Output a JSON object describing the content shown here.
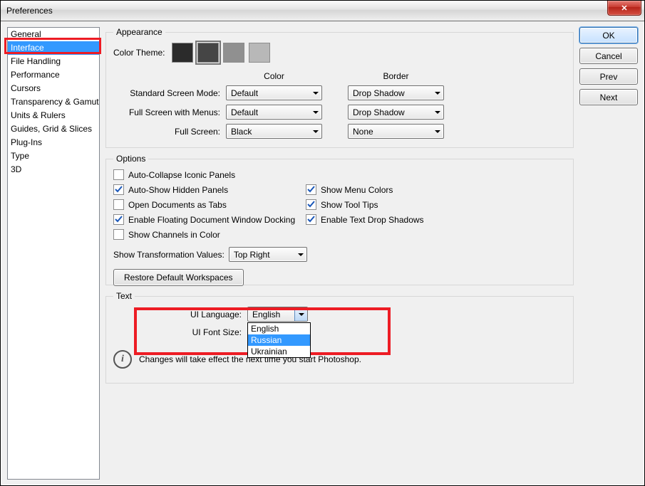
{
  "window": {
    "title": "Preferences"
  },
  "categories": [
    "General",
    "Interface",
    "File Handling",
    "Performance",
    "Cursors",
    "Transparency & Gamut",
    "Units & Rulers",
    "Guides, Grid & Slices",
    "Plug-Ins",
    "Type",
    "3D"
  ],
  "selected_category_index": 1,
  "buttons": {
    "ok": "OK",
    "cancel": "Cancel",
    "prev": "Prev",
    "next": "Next"
  },
  "appearance": {
    "legend": "Appearance",
    "color_theme_label": "Color Theme:",
    "theme_colors": [
      "#2b2b2b",
      "#454545",
      "#909090",
      "#b8b8b8"
    ],
    "selected_theme_index": 1,
    "col_color": "Color",
    "col_border": "Border",
    "rows": [
      {
        "label": "Standard Screen Mode:",
        "color": "Default",
        "border": "Drop Shadow"
      },
      {
        "label": "Full Screen with Menus:",
        "color": "Default",
        "border": "Drop Shadow"
      },
      {
        "label": "Full Screen:",
        "color": "Black",
        "border": "None"
      }
    ]
  },
  "options": {
    "legend": "Options",
    "left": [
      {
        "label": "Auto-Collapse Iconic Panels",
        "checked": false
      },
      {
        "label": "Auto-Show Hidden Panels",
        "checked": true
      },
      {
        "label": "Open Documents as Tabs",
        "checked": false
      },
      {
        "label": "Enable Floating Document Window Docking",
        "checked": true
      },
      {
        "label": "Show Channels in Color",
        "checked": false
      }
    ],
    "right": [
      {
        "label": "Show Menu Colors",
        "checked": true
      },
      {
        "label": "Show Tool Tips",
        "checked": true
      },
      {
        "label": "Enable Text Drop Shadows",
        "checked": true
      }
    ],
    "show_transform_label": "Show Transformation Values:",
    "show_transform_value": "Top Right",
    "restore_btn": "Restore Default Workspaces"
  },
  "text": {
    "legend": "Text",
    "ui_language_label": "UI Language:",
    "ui_language_value": "English",
    "ui_language_options": [
      "English",
      "Russian",
      "Ukrainian"
    ],
    "ui_language_option_selected_index": 1,
    "ui_font_size_label": "UI Font Size:",
    "info": "Changes will take effect the next time you start Photoshop."
  }
}
